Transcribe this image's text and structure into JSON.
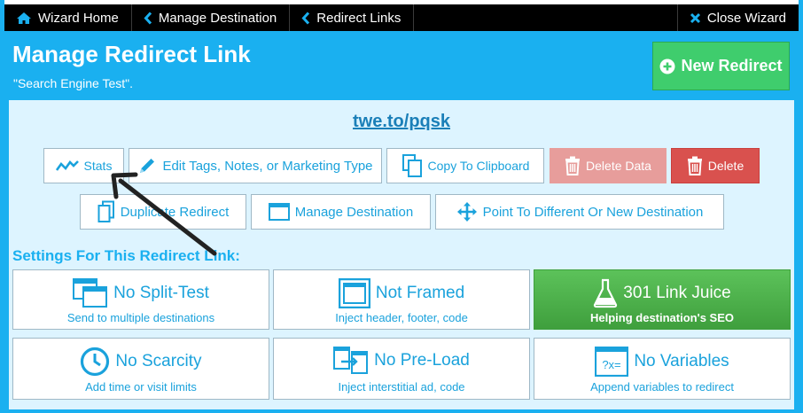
{
  "nav": {
    "wizard_home": "Wizard Home",
    "manage_destination": "Manage Destination",
    "redirect_links": "Redirect Links",
    "close_wizard": "Close Wizard"
  },
  "header": {
    "title": "Manage Redirect Link",
    "subtitle": "\"Search Engine Test\".",
    "new_redirect": "New Redirect"
  },
  "link": "twe.to/pqsk",
  "actions": {
    "stats": "Stats",
    "edit_tags": "Edit Tags, Notes, or Marketing Type",
    "copy": "Copy To Clipboard",
    "delete_data": "Delete Data",
    "delete": "Delete",
    "duplicate": "Duplicate Redirect",
    "manage_destination": "Manage Destination",
    "point_to": "Point To Different Or New Destination"
  },
  "settings": {
    "heading": "Settings For This Redirect Link:",
    "split_test": {
      "title": "No Split-Test",
      "sub": "Send to multiple destinations"
    },
    "framed": {
      "title": "Not Framed",
      "sub": "Inject header, footer, code"
    },
    "link_juice": {
      "title": "301 Link Juice",
      "sub": "Helping destination's SEO"
    },
    "scarcity": {
      "title": "No Scarcity",
      "sub": "Add time or visit limits"
    },
    "preload": {
      "title": "No Pre-Load",
      "sub": "Inject interstitial ad, code"
    },
    "variables": {
      "title": "No Variables",
      "sub": "Append variables to redirect"
    }
  },
  "colors": {
    "accent": "#1ab0f0",
    "panel": "#ddf4ff",
    "success": "#3fcd6d",
    "danger": "#d9514e",
    "danger_light": "#e79d9b",
    "active_setting": "#4cb04a"
  }
}
